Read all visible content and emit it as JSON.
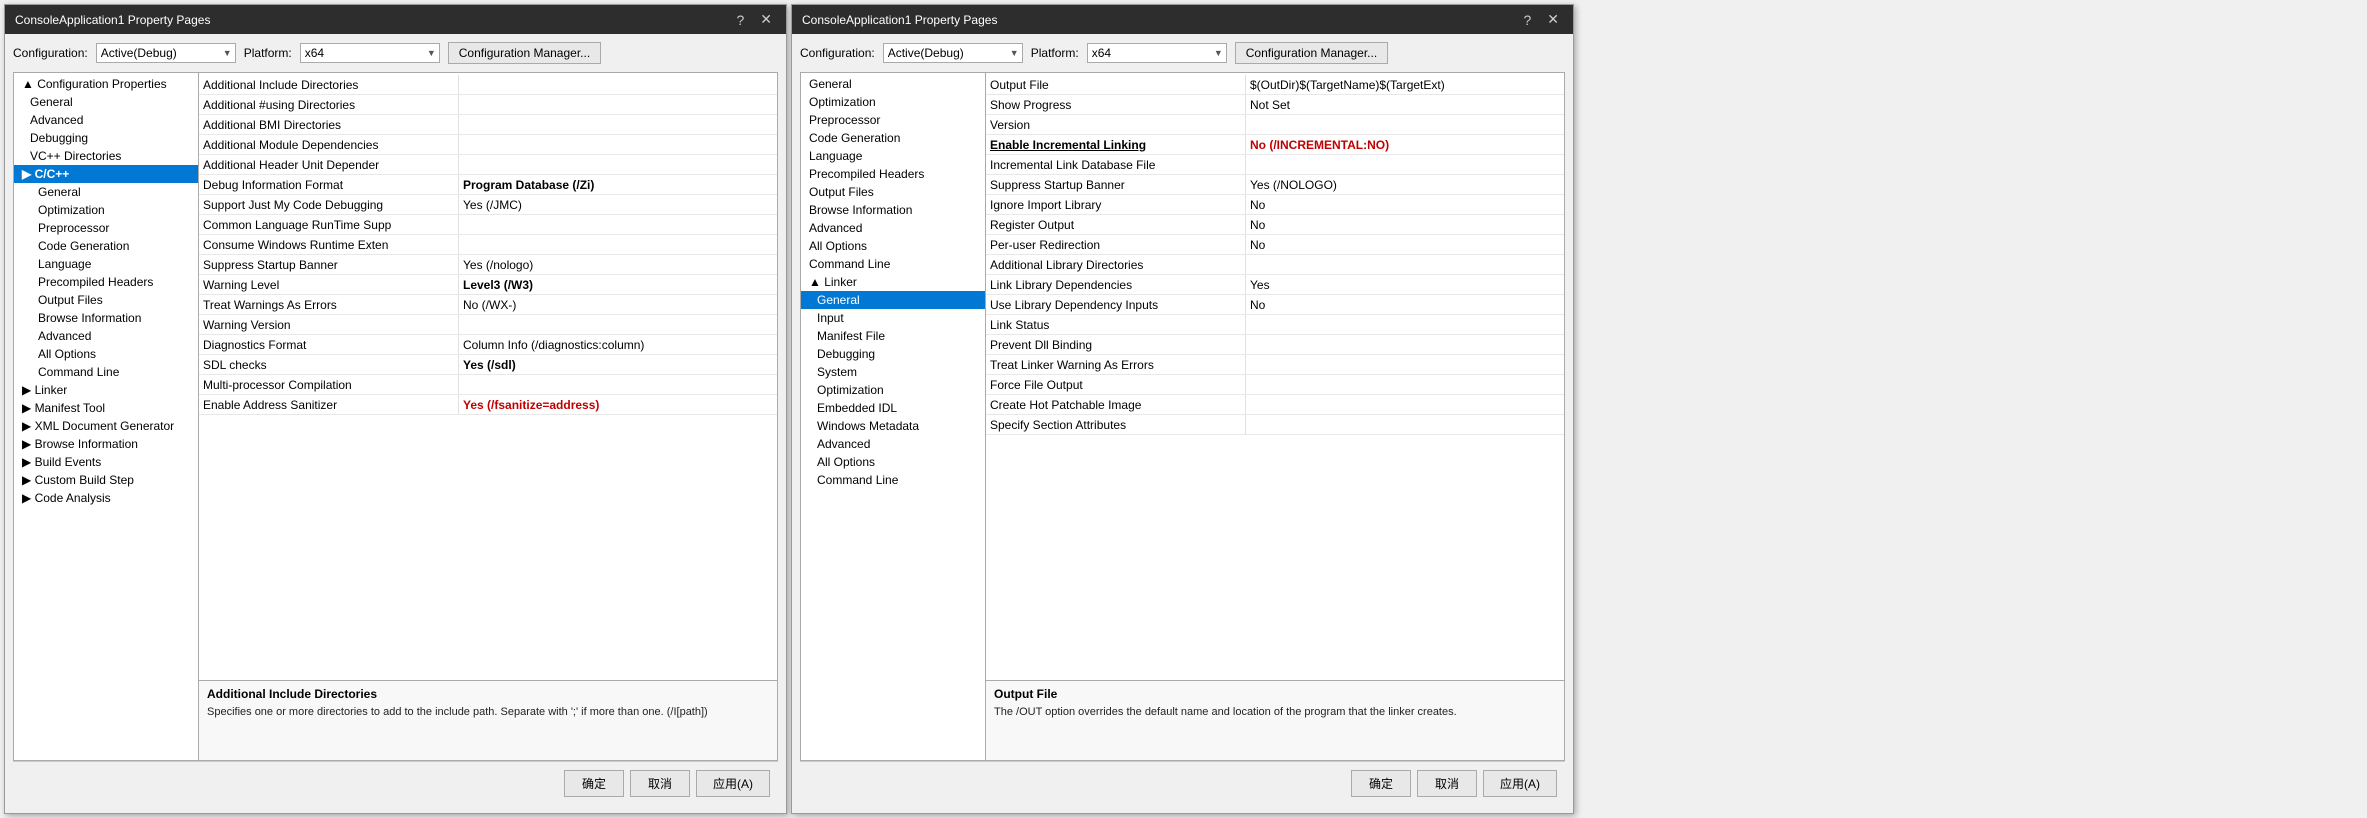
{
  "dialog1": {
    "title": "ConsoleApplication1 Property Pages",
    "config_label": "Configuration:",
    "config_value": "Active(Debug)",
    "platform_label": "Platform:",
    "platform_value": "x64",
    "config_manager_btn": "Configuration Manager...",
    "confirm_btn": "确定",
    "cancel_btn": "取消",
    "apply_btn": "应用(A)",
    "tree": [
      {
        "label": "▲ Configuration Properties",
        "level": 0,
        "expand": true
      },
      {
        "label": "General",
        "level": 1
      },
      {
        "label": "Advanced",
        "level": 1
      },
      {
        "label": "Debugging",
        "level": 1
      },
      {
        "label": "VC++ Directories",
        "level": 1
      },
      {
        "label": "▶ C/C++",
        "level": 0,
        "selected": true,
        "bold": true
      },
      {
        "label": "General",
        "level": 2
      },
      {
        "label": "Optimization",
        "level": 2
      },
      {
        "label": "Preprocessor",
        "level": 2
      },
      {
        "label": "Code Generation",
        "level": 2
      },
      {
        "label": "Language",
        "level": 2
      },
      {
        "label": "Precompiled Headers",
        "level": 2
      },
      {
        "label": "Output Files",
        "level": 2
      },
      {
        "label": "Browse Information",
        "level": 2
      },
      {
        "label": "Advanced",
        "level": 2
      },
      {
        "label": "All Options",
        "level": 2
      },
      {
        "label": "Command Line",
        "level": 2
      },
      {
        "label": "▶ Linker",
        "level": 0
      },
      {
        "label": "▶ Manifest Tool",
        "level": 0
      },
      {
        "label": "▶ XML Document Generator",
        "level": 0
      },
      {
        "label": "▶ Browse Information",
        "level": 0
      },
      {
        "label": "▶ Build Events",
        "level": 0
      },
      {
        "label": "▶ Custom Build Step",
        "level": 0
      },
      {
        "label": "▶ Code Analysis",
        "level": 0
      }
    ],
    "props": [
      {
        "name": "Additional Include Directories",
        "value": "",
        "name_style": "",
        "value_style": ""
      },
      {
        "name": "Additional #using Directories",
        "value": "",
        "name_style": "",
        "value_style": ""
      },
      {
        "name": "Additional BMI Directories",
        "value": "",
        "name_style": "",
        "value_style": ""
      },
      {
        "name": "Additional Module Dependencies",
        "value": "",
        "name_style": "",
        "value_style": ""
      },
      {
        "name": "Additional Header Unit Depender",
        "value": "",
        "name_style": "",
        "value_style": ""
      },
      {
        "name": "Debug Information Format",
        "value": "Program Database (/Zi)",
        "name_style": "",
        "value_style": "bold"
      },
      {
        "name": "Support Just My Code Debugging",
        "value": "Yes (/JMC)",
        "name_style": "",
        "value_style": ""
      },
      {
        "name": "Common Language RunTime Supp",
        "value": "",
        "name_style": "",
        "value_style": ""
      },
      {
        "name": "Consume Windows Runtime Exten",
        "value": "",
        "name_style": "",
        "value_style": ""
      },
      {
        "name": "Suppress Startup Banner",
        "value": "Yes (/nologo)",
        "name_style": "",
        "value_style": ""
      },
      {
        "name": "Warning Level",
        "value": "Level3 (/W3)",
        "name_style": "",
        "value_style": "bold"
      },
      {
        "name": "Treat Warnings As Errors",
        "value": "No (/WX-)",
        "name_style": "",
        "value_style": ""
      },
      {
        "name": "Warning Version",
        "value": "",
        "name_style": "",
        "value_style": ""
      },
      {
        "name": "Diagnostics Format",
        "value": "Column Info (/diagnostics:column)",
        "name_style": "",
        "value_style": ""
      },
      {
        "name": "SDL checks",
        "value": "Yes (/sdl)",
        "name_style": "",
        "value_style": "bold"
      },
      {
        "name": "Multi-processor Compilation",
        "value": "",
        "name_style": "",
        "value_style": ""
      },
      {
        "name": "Enable Address Sanitizer",
        "value": "Yes (/fsanitize=address)",
        "name_style": "",
        "value_style": "red"
      }
    ],
    "description": {
      "title": "Additional Include Directories",
      "text": "Specifies one or more directories to add to the include path. Separate with ';' if more than one. (/I[path])"
    }
  },
  "dialog2": {
    "title": "ConsoleApplication1 Property Pages",
    "config_label": "Configuration:",
    "config_value": "Active(Debug)",
    "platform_label": "Platform:",
    "platform_value": "x64",
    "config_manager_btn": "Configuration Manager...",
    "confirm_btn": "确定",
    "cancel_btn": "取消",
    "apply_btn": "应用(A)",
    "tree": [
      {
        "label": "General",
        "level": 0
      },
      {
        "label": "Optimization",
        "level": 0
      },
      {
        "label": "Preprocessor",
        "level": 0
      },
      {
        "label": "Code Generation",
        "level": 0
      },
      {
        "label": "Language",
        "level": 0
      },
      {
        "label": "Precompiled Headers",
        "level": 0
      },
      {
        "label": "Output Files",
        "level": 0
      },
      {
        "label": "Browse Information",
        "level": 0
      },
      {
        "label": "Advanced",
        "level": 0
      },
      {
        "label": "All Options",
        "level": 0
      },
      {
        "label": "Command Line",
        "level": 0
      },
      {
        "label": "▲ Linker",
        "level": 0,
        "expand": true
      },
      {
        "label": "General",
        "level": 1,
        "selected": true
      },
      {
        "label": "Input",
        "level": 1
      },
      {
        "label": "Manifest File",
        "level": 1
      },
      {
        "label": "Debugging",
        "level": 1
      },
      {
        "label": "System",
        "level": 1
      },
      {
        "label": "Optimization",
        "level": 1
      },
      {
        "label": "Embedded IDL",
        "level": 1
      },
      {
        "label": "Windows Metadata",
        "level": 1
      },
      {
        "label": "Advanced",
        "level": 1
      },
      {
        "label": "All Options",
        "level": 1
      },
      {
        "label": "Command Line",
        "level": 1
      }
    ],
    "props": [
      {
        "name": "Output File",
        "value": "$(OutDir)$(TargetName)$(TargetExt)",
        "name_style": "",
        "value_style": ""
      },
      {
        "name": "Show Progress",
        "value": "Not Set",
        "name_style": "",
        "value_style": ""
      },
      {
        "name": "Version",
        "value": "",
        "name_style": "",
        "value_style": ""
      },
      {
        "name": "Enable Incremental Linking",
        "value": "No (/INCREMENTAL:NO)",
        "name_style": "underline bold",
        "value_style": "red"
      },
      {
        "name": "Incremental Link Database File",
        "value": "",
        "name_style": "",
        "value_style": ""
      },
      {
        "name": "Suppress Startup Banner",
        "value": "Yes (/NOLOGO)",
        "name_style": "",
        "value_style": ""
      },
      {
        "name": "Ignore Import Library",
        "value": "No",
        "name_style": "",
        "value_style": ""
      },
      {
        "name": "Register Output",
        "value": "No",
        "name_style": "",
        "value_style": ""
      },
      {
        "name": "Per-user Redirection",
        "value": "No",
        "name_style": "",
        "value_style": ""
      },
      {
        "name": "Additional Library Directories",
        "value": "",
        "name_style": "",
        "value_style": ""
      },
      {
        "name": "Link Library Dependencies",
        "value": "Yes",
        "name_style": "",
        "value_style": ""
      },
      {
        "name": "Use Library Dependency Inputs",
        "value": "No",
        "name_style": "",
        "value_style": ""
      },
      {
        "name": "Link Status",
        "value": "",
        "name_style": "",
        "value_style": ""
      },
      {
        "name": "Prevent Dll Binding",
        "value": "",
        "name_style": "",
        "value_style": ""
      },
      {
        "name": "Treat Linker Warning As Errors",
        "value": "",
        "name_style": "",
        "value_style": ""
      },
      {
        "name": "Force File Output",
        "value": "",
        "name_style": "",
        "value_style": ""
      },
      {
        "name": "Create Hot Patchable Image",
        "value": "",
        "name_style": "",
        "value_style": ""
      },
      {
        "name": "Specify Section Attributes",
        "value": "",
        "name_style": "",
        "value_style": ""
      }
    ],
    "description": {
      "title": "Output File",
      "text": "The /OUT option overrides the default name and location of the program that the linker creates."
    }
  }
}
